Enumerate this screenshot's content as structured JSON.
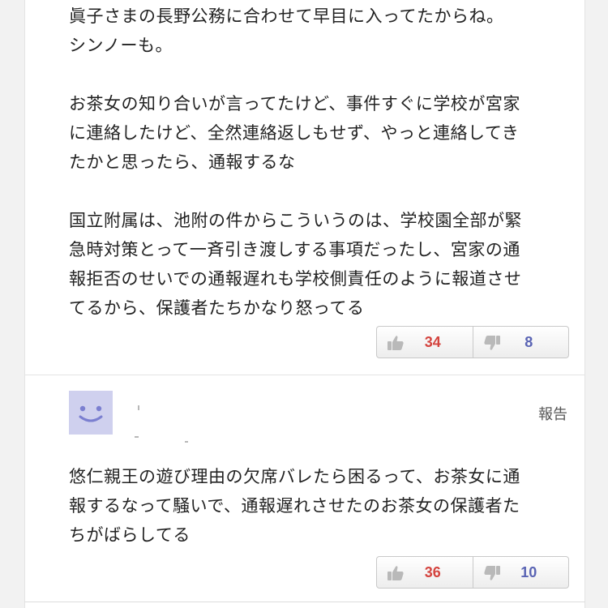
{
  "comments": [
    {
      "body": "眞子さまの長野公務に合わせて早目に入ってたからね。\nシンノーも。\n\nお茶女の知り合いが言ってたけど、事件すぐに学校が宮家\nに連絡したけど、全然連絡返しもせず、やっと連絡してき\nたかと思ったら、通報するな\n\n国立附属は、池附の件からこういうのは、学校園全部が緊\n急時対策とって一斉引き渡しする事項だったし、宮家の通\n報拒否のせいでの通報遅れも学校側責任のように報道させ\nてるから、保護者たちかなり怒ってる",
      "likes": "34",
      "dislikes": "8"
    },
    {
      "report_label": "報告",
      "avatar_icon": "smiley-face-icon",
      "avatar_color": "#cfd0ee",
      "body": "悠仁親王の遊び理由の欠席バレたら困るって、お茶女に通\n報するなって騒いで、通報遅れさせたのお茶女の保護者た\nちがばらしてる",
      "likes": "36",
      "dislikes": "10"
    }
  ],
  "icons": {
    "like": "thumbs-up-icon",
    "dislike": "thumbs-down-icon"
  },
  "colors": {
    "like_count": "#d4443f",
    "dislike_count": "#5a64b4",
    "avatar_bg": "#cfd0ee",
    "avatar_face": "#7b7fd0"
  }
}
